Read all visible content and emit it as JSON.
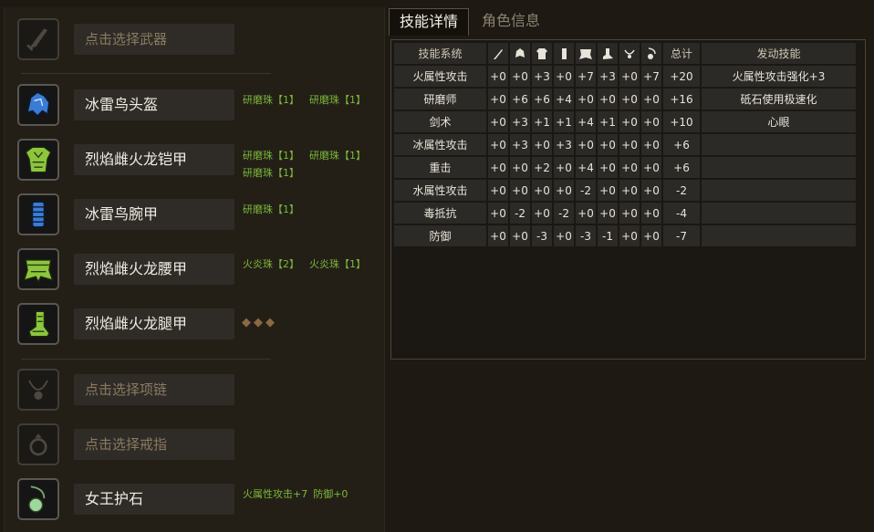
{
  "equipment": {
    "weapon": {
      "label": "点击选择武器",
      "icon": "sword-icon"
    },
    "head": {
      "name": "冰雷鸟头盔",
      "icon": "helmet-icon",
      "jewels": [
        "研磨珠【1】",
        "研磨珠【1】"
      ]
    },
    "chest": {
      "name": "烈焰雌火龙铠甲",
      "icon": "chest-armor-icon",
      "jewels": [
        "研磨珠【1】",
        "研磨珠【1】",
        "研磨珠【1】"
      ]
    },
    "arms": {
      "name": "冰雷鸟腕甲",
      "icon": "arm-armor-icon",
      "jewels": [
        "研磨珠【1】"
      ]
    },
    "waist": {
      "name": "烈焰雌火龙腰甲",
      "icon": "waist-armor-icon",
      "jewels": [
        "火炎珠【2】",
        "火炎珠【1】"
      ]
    },
    "legs": {
      "name": "烈焰雌火龙腿甲",
      "icon": "leg-armor-icon",
      "sockets": "◆◆◆"
    },
    "necklace": {
      "label": "点击选择项链",
      "icon": "necklace-icon"
    },
    "ring": {
      "label": "点击选择戒指",
      "icon": "ring-icon"
    },
    "talisman": {
      "name": "女王护石",
      "icon": "talisman-icon",
      "skills": [
        "火属性攻击+7",
        "防御+0"
      ]
    }
  },
  "tabs": {
    "skills": "技能详情",
    "character": "角色信息"
  },
  "skill_table": {
    "headers": {
      "system": "技能系统",
      "total": "总计",
      "activated": "发动技能"
    },
    "slot_icons": [
      "weapon-icon",
      "helmet-icon",
      "chest-icon",
      "arm-icon",
      "waist-icon",
      "leg-icon",
      "amulet-icon",
      "talisman-icon"
    ],
    "rows": [
      {
        "name": "火属性攻击",
        "values": [
          "+0",
          "+0",
          "+3",
          "+0",
          "+7",
          "+3",
          "+0",
          "+7"
        ],
        "total": "+20",
        "activated": "火属性攻击强化+3"
      },
      {
        "name": "研磨师",
        "values": [
          "+0",
          "+6",
          "+6",
          "+4",
          "+0",
          "+0",
          "+0",
          "+0"
        ],
        "total": "+16",
        "activated": "砥石使用极速化"
      },
      {
        "name": "剑术",
        "values": [
          "+0",
          "+3",
          "+1",
          "+1",
          "+4",
          "+1",
          "+0",
          "+0"
        ],
        "total": "+10",
        "activated": "心眼"
      },
      {
        "name": "冰属性攻击",
        "values": [
          "+0",
          "+3",
          "+0",
          "+3",
          "+0",
          "+0",
          "+0",
          "+0"
        ],
        "total": "+6",
        "activated": ""
      },
      {
        "name": "重击",
        "values": [
          "+0",
          "+0",
          "+2",
          "+0",
          "+4",
          "+0",
          "+0",
          "+0"
        ],
        "total": "+6",
        "activated": ""
      },
      {
        "name": "水属性攻击",
        "values": [
          "+0",
          "+0",
          "+0",
          "+0",
          "-2",
          "+0",
          "+0",
          "+0"
        ],
        "total": "-2",
        "activated": ""
      },
      {
        "name": "毒抵抗",
        "values": [
          "+0",
          "-2",
          "+0",
          "-2",
          "+0",
          "+0",
          "+0",
          "+0"
        ],
        "total": "-4",
        "activated": ""
      },
      {
        "name": "防御",
        "values": [
          "+0",
          "+0",
          "-3",
          "+0",
          "-3",
          "-1",
          "+0",
          "+0"
        ],
        "total": "-7",
        "activated": ""
      }
    ]
  },
  "colors": {
    "jewel_text": "#7cb83a",
    "armor_green": "#8cc63f",
    "armor_blue": "#3a7bd5"
  }
}
